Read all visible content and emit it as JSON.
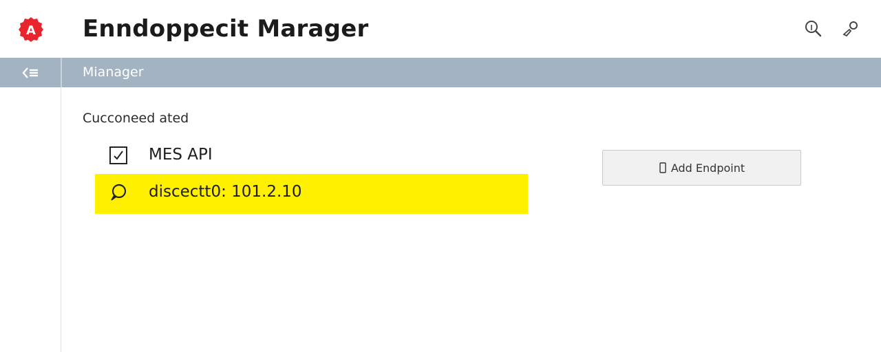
{
  "header": {
    "logo_letter": "A",
    "title": "Enndoppecit Marager",
    "search_icon": "search-icon",
    "user_icon": "user-icon"
  },
  "subbar": {
    "title": "Mianager",
    "collapse_icon": "collapse-icon"
  },
  "main": {
    "section_label": "Cucconeed ated",
    "endpoints": [
      {
        "label": "MES API",
        "icon": "checkbox-checked-icon",
        "highlighted": false
      },
      {
        "label": "discectt0: 101.2.10",
        "icon": "chat-bubble-icon",
        "highlighted": true
      }
    ],
    "add_button_label": "Add Endpoint",
    "add_button_icon": "bracket-icon"
  },
  "colors": {
    "logo": "#e8252d",
    "subbar": "#a3b3c1",
    "highlight": "#fff000",
    "button_bg": "#f1f1f1"
  }
}
